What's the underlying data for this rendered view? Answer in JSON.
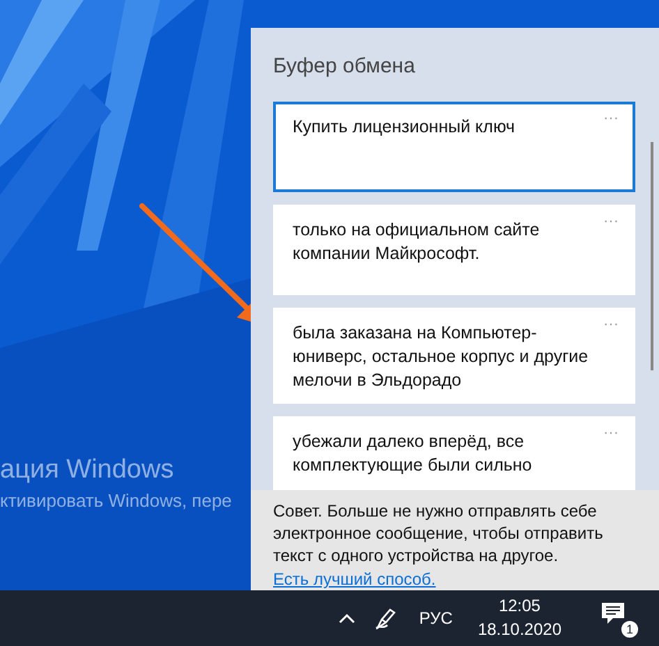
{
  "desktop": {
    "watermark_title": "ация Windows",
    "watermark_text": "ктивировать Windows, пере"
  },
  "clipboard": {
    "title": "Буфер обмена",
    "items": [
      {
        "text": "Купить лицензионный ключ",
        "selected": true,
        "more": "···"
      },
      {
        "text": "только на официальном сайте компании Майкрософт.",
        "selected": false,
        "more": "···"
      },
      {
        "text": "была заказана на Компьютер-юниверс, остальное корпус и другие мелочи в Эльдорадо",
        "selected": false,
        "more": "···"
      },
      {
        "text": "убежали далеко вперёд, все комплектующие были сильно",
        "selected": false,
        "more": "···"
      }
    ],
    "tip": {
      "text": "Совет. Больше не нужно отправлять себе электронное сообщение, чтобы отправить текст с одного устройства на другое.",
      "link": "Есть лучший способ."
    }
  },
  "taskbar": {
    "language": "РУС",
    "time": "12:05",
    "date": "18.10.2020",
    "notifications": "1"
  }
}
